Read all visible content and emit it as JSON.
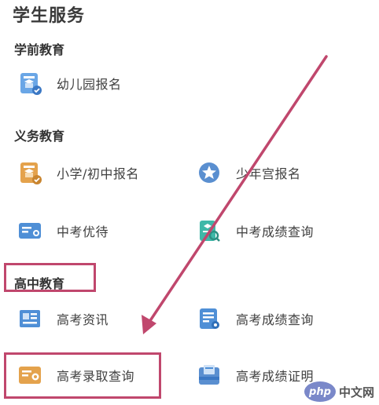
{
  "title": "学生服务",
  "sections": {
    "preschool": {
      "title": "学前教育",
      "items": [
        {
          "label": "幼儿园报名",
          "icon": "kindergarten-signup-icon"
        }
      ]
    },
    "compulsory": {
      "title": "义务教育",
      "items": [
        {
          "label": "小学/初中报名",
          "icon": "school-signup-icon"
        },
        {
          "label": "少年宫报名",
          "icon": "youth-palace-icon"
        },
        {
          "label": "中考优待",
          "icon": "exam-preference-icon"
        },
        {
          "label": "中考成绩查询",
          "icon": "exam-score-search-icon"
        }
      ]
    },
    "highschool": {
      "title": "高中教育",
      "items": [
        {
          "label": "高考资讯",
          "icon": "news-icon"
        },
        {
          "label": "高考成绩查询",
          "icon": "score-document-icon"
        },
        {
          "label": "高考录取查询",
          "icon": "admission-search-icon"
        },
        {
          "label": "高考成绩证明",
          "icon": "score-certificate-icon"
        }
      ]
    }
  },
  "watermark": {
    "brand": "php",
    "text": "中文网"
  },
  "colors": {
    "highlight": "#c0476d",
    "icon_blue": "#4f8fd6",
    "icon_orange": "#e4a24c",
    "icon_teal": "#3fb8a8"
  }
}
